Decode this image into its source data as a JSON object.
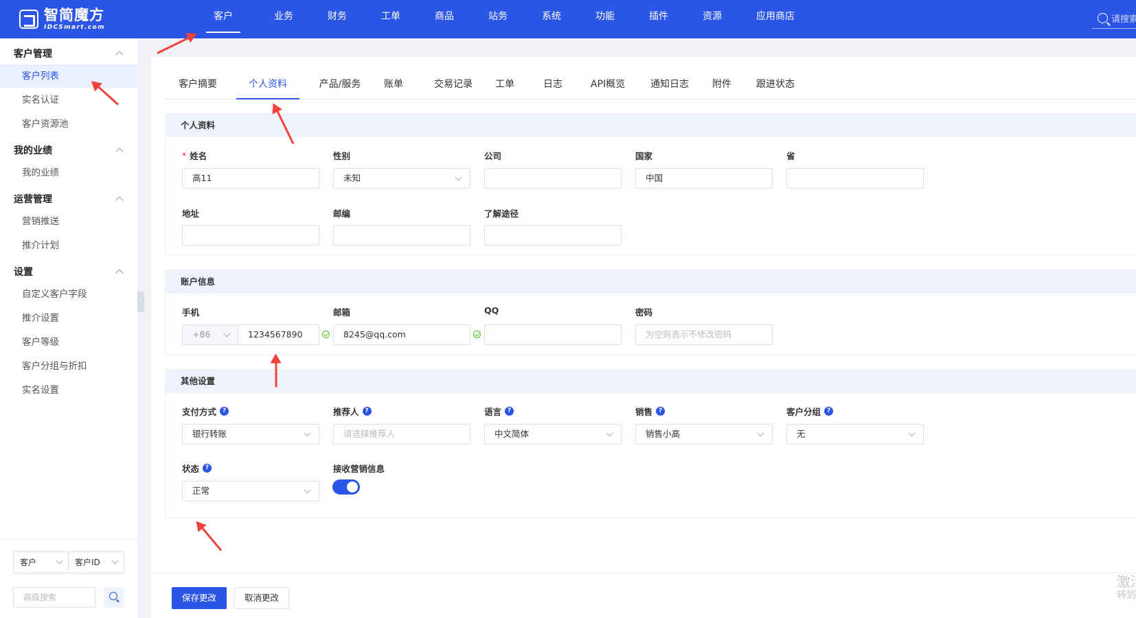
{
  "brand": {
    "title": "智简魔方",
    "subtitle": "IDCSmart.com"
  },
  "top_nav": [
    "客户",
    "业务",
    "财务",
    "工单",
    "商品",
    "站务",
    "系统",
    "功能",
    "插件",
    "资源",
    "应用商店"
  ],
  "top_nav_active": "客户",
  "top_search": {
    "placeholder": "请搜索"
  },
  "sidebar": {
    "groups": [
      {
        "label": "客户管理",
        "items": [
          "客户列表",
          "实名认证",
          "客户资源池"
        ]
      },
      {
        "label": "我的业绩",
        "items": [
          "我的业绩"
        ]
      },
      {
        "label": "运营管理",
        "items": [
          "营销推送",
          "推介计划"
        ]
      },
      {
        "label": "设置",
        "items": [
          "自定义客户字段",
          "推介设置",
          "客户等级",
          "客户分组与折扣",
          "实名设置"
        ]
      }
    ],
    "active_item": "客户列表",
    "search": {
      "type_select": "客户",
      "field_select": "客户ID",
      "advanced_placeholder": "高级搜索"
    }
  },
  "tabs": [
    "客户摘要",
    "个人资料",
    "产品/服务",
    "账单",
    "交易记录",
    "工单",
    "日志",
    "API概览",
    "通知日志",
    "附件",
    "跟进状态"
  ],
  "tab_active": "个人资料",
  "profile": {
    "title": "个人资料",
    "name_label": "姓名",
    "name_value": "高11",
    "gender_label": "性别",
    "gender_value": "未知",
    "company_label": "公司",
    "company_value": "",
    "country_label": "国家",
    "country_value": "中国",
    "province_label": "省",
    "province_value": "",
    "address_label": "地址",
    "address_value": "",
    "zip_label": "邮编",
    "zip_value": "",
    "source_label": "了解途径",
    "source_value": ""
  },
  "account": {
    "title": "账户信息",
    "phone_label": "手机",
    "phone_code": "+86",
    "phone_value": "1234567890",
    "email_label": "邮箱",
    "email_value": "8245@qq.com",
    "qq_label": "QQ",
    "qq_value": "",
    "password_label": "密码",
    "password_placeholder": "为空则表示不修改密码"
  },
  "other": {
    "title": "其他设置",
    "payment_label": "支付方式",
    "payment_value": "银行转账",
    "referrer_label": "推荐人",
    "referrer_placeholder": "请选择推荐人",
    "language_label": "语言",
    "language_value": "中文简体",
    "sales_label": "销售",
    "sales_value": "销售小高",
    "group_label": "客户分组",
    "group_value": "无",
    "status_label": "状态",
    "status_value": "正常",
    "marketing_label": "接收营销信息",
    "marketing_enabled": true
  },
  "actions": {
    "save": "保存更改",
    "cancel": "取消更改"
  },
  "watermark": {
    "line1": "激活",
    "line2": "转到"
  },
  "colors": {
    "primary": "#2b55e6",
    "annotation": "#f0413b",
    "success": "#52c41a"
  }
}
